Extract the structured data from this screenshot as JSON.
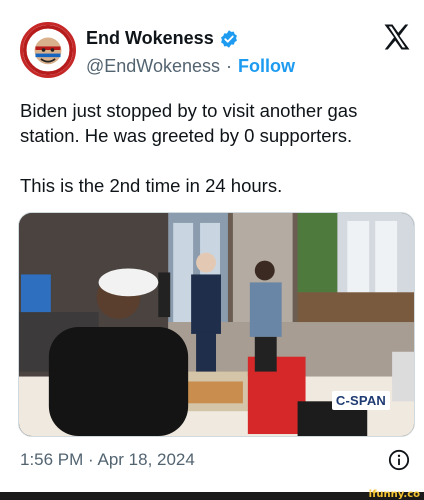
{
  "user": {
    "display_name": "End Wokeness",
    "handle": "@EndWokeness",
    "separator": "·",
    "follow_label": "Follow",
    "avatar_text_top": "EUROPE FOR",
    "avatar_text_bottom": "FORMER TRUMP"
  },
  "tweet": {
    "paragraph_1": "Biden just stopped by to visit another gas station. He was greeted by 0 supporters.",
    "paragraph_2": "This is the 2nd time in 24 hours."
  },
  "media": {
    "watermark": "C-SPAN"
  },
  "footer": {
    "timestamp": "1:56 PM · Apr 18, 2024"
  },
  "overlay": {
    "site_mark": "ifunny.co"
  },
  "colors": {
    "link": "#1d9bf0",
    "verified": "#1d9bf0",
    "muted": "#536471",
    "text": "#0f1419"
  },
  "icons": [
    "verified-badge-icon",
    "x-logo-icon",
    "info-icon"
  ]
}
